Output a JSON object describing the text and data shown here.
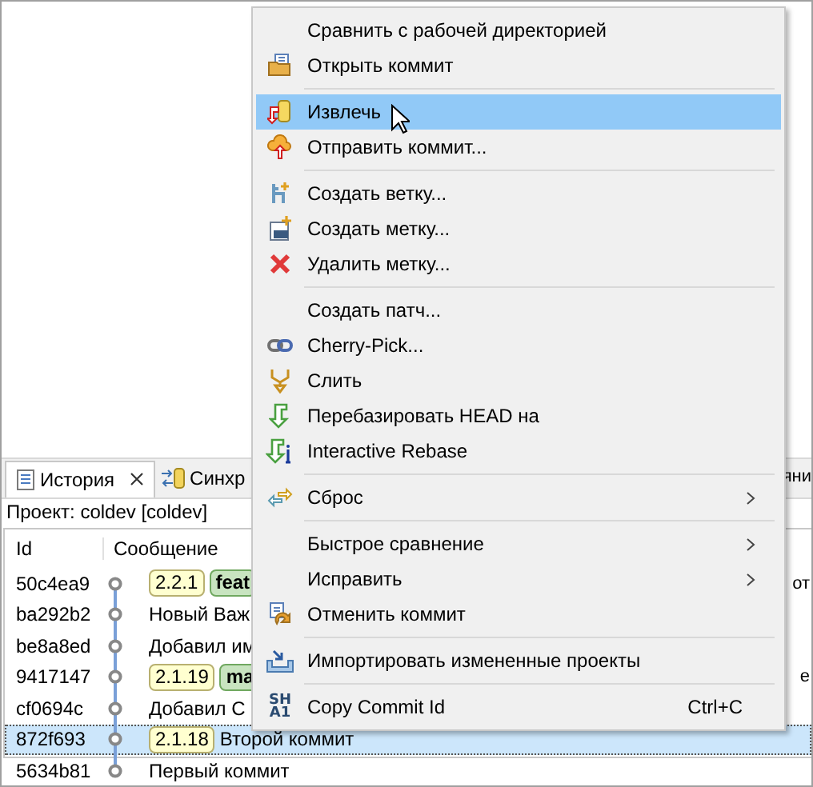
{
  "view": {
    "tabs": [
      {
        "label": "История",
        "selected": true
      },
      {
        "label": "Синхр",
        "selected": false
      }
    ],
    "tab_overflow_text": "яни",
    "project_label": "Проект: coldev [coldev]",
    "table": {
      "columns": [
        "Id",
        "Сообщение"
      ],
      "rows": [
        {
          "id": "50c4ea9",
          "tags": [
            {
              "label": "2.2.1",
              "kind": "tag"
            },
            {
              "label": "feat",
              "kind": "branch"
            }
          ],
          "message": "",
          "trailing_text": "от",
          "selected": false
        },
        {
          "id": "ba292b2",
          "tags": [],
          "message": "Новый Важ",
          "trailing_text": "",
          "selected": false
        },
        {
          "id": "be8a8ed",
          "tags": [],
          "message": "Добавил им",
          "trailing_text": "",
          "selected": false
        },
        {
          "id": "9417147",
          "tags": [
            {
              "label": "2.1.19",
              "kind": "tag"
            },
            {
              "label": "ma",
              "kind": "branch"
            }
          ],
          "message": "",
          "trailing_text": "е",
          "selected": false
        },
        {
          "id": "cf0694c",
          "tags": [],
          "message": "Добавил С",
          "trailing_text": "",
          "selected": false
        },
        {
          "id": "872f693",
          "tags": [
            {
              "label": "2.1.18",
              "kind": "tag"
            }
          ],
          "message": "Второй коммит",
          "trailing_text": "",
          "selected": true
        },
        {
          "id": "5634b81",
          "tags": [],
          "message": "Первый коммит",
          "trailing_text": "",
          "selected": false
        }
      ]
    }
  },
  "context_menu": {
    "items": [
      {
        "kind": "item",
        "label": "Сравнить с рабочей директорией",
        "highlighted": false
      },
      {
        "kind": "item",
        "label": "Открыть коммит",
        "highlighted": false
      },
      {
        "kind": "separator"
      },
      {
        "kind": "item",
        "label": "Извлечь",
        "highlighted": true
      },
      {
        "kind": "item",
        "label": "Отправить коммит...",
        "highlighted": false
      },
      {
        "kind": "separator"
      },
      {
        "kind": "item",
        "label": "Создать ветку...",
        "highlighted": false
      },
      {
        "kind": "item",
        "label": "Создать метку...",
        "highlighted": false
      },
      {
        "kind": "item",
        "label": "Удалить метку...",
        "highlighted": false
      },
      {
        "kind": "separator"
      },
      {
        "kind": "item",
        "label": "Создать патч...",
        "highlighted": false
      },
      {
        "kind": "item",
        "label": "Cherry-Pick...",
        "highlighted": false
      },
      {
        "kind": "item",
        "label": "Слить",
        "highlighted": false
      },
      {
        "kind": "item",
        "label": "Перебазировать HEAD на",
        "highlighted": false
      },
      {
        "kind": "item",
        "label": "Interactive Rebase",
        "highlighted": false
      },
      {
        "kind": "separator"
      },
      {
        "kind": "item",
        "label": "Сброс",
        "highlighted": false,
        "submenu": true
      },
      {
        "kind": "separator"
      },
      {
        "kind": "item",
        "label": "Быстрое сравнение",
        "highlighted": false,
        "submenu": true
      },
      {
        "kind": "item",
        "label": "Исправить",
        "highlighted": false,
        "submenu": true
      },
      {
        "kind": "item",
        "label": "Отменить коммит",
        "highlighted": false
      },
      {
        "kind": "separator"
      },
      {
        "kind": "item",
        "label": "Импортировать измененные проекты",
        "highlighted": false
      },
      {
        "kind": "separator"
      },
      {
        "kind": "item",
        "label": "Copy Commit Id",
        "icon_text": "SH A1",
        "highlighted": false,
        "shortcut": "Ctrl+C"
      }
    ]
  }
}
